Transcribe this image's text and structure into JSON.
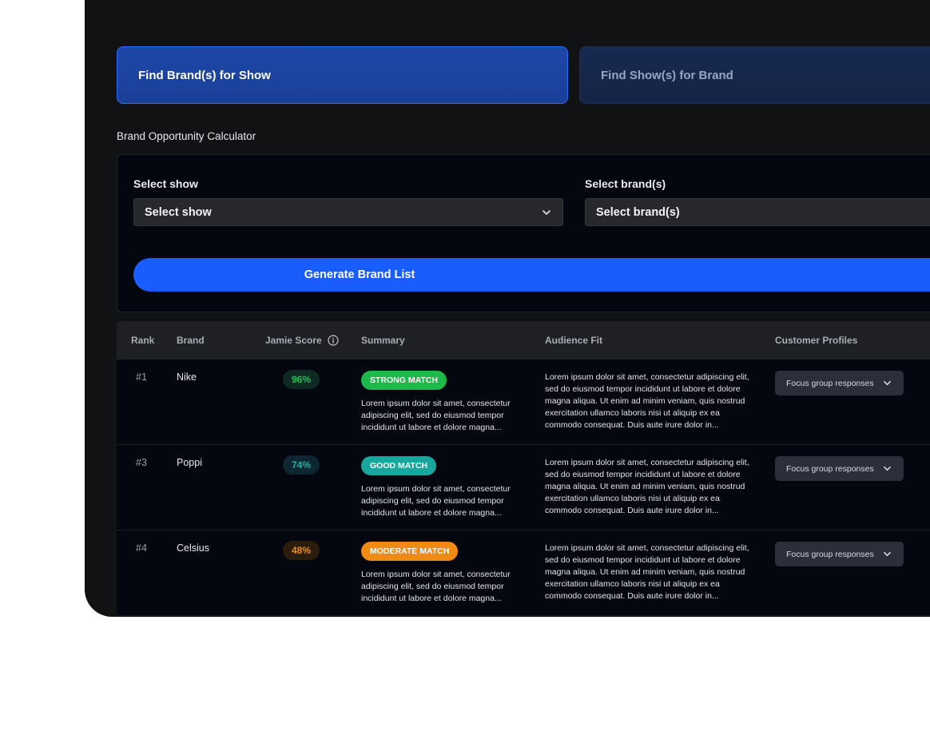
{
  "tabs": [
    {
      "label": "Find Brand(s) for Show",
      "active": true
    },
    {
      "label": "Find Show(s) for Brand",
      "active": false
    }
  ],
  "calculator": {
    "title": "Brand Opportunity Calculator",
    "show_label": "Select show",
    "show_value": "Select show",
    "brand_label": "Select brand(s)",
    "brand_value": "Select brand(s)",
    "generate_label": "Generate Brand List"
  },
  "table": {
    "headers": {
      "rank": "Rank",
      "brand": "Brand",
      "score": "Jamie Score",
      "summary": "Summary",
      "fit": "Audience Fit",
      "profiles": "Customer Profiles"
    },
    "rows": [
      {
        "rank": "#1",
        "brand": "Nike",
        "score": "96%",
        "match": "STRONG MATCH",
        "summary": "Lorem ipsum dolor sit amet, consectetur adipiscing elit, sed do eiusmod tempor incididunt ut labore et dolore magna...",
        "fit": "Lorem ipsum dolor sit amet, consectetur adipiscing elit, sed do eiusmod tempor incididunt ut labore et dolore magna aliqua. Ut enim ad minim veniam, quis nostrud exercitation ullamco laboris nisi ut aliquip ex ea commodo consequat. Duis aute irure dolor in...",
        "profiles": "Focus group responses"
      },
      {
        "rank": "#3",
        "brand": "Poppi",
        "score": "74%",
        "match": "GOOD MATCH",
        "summary": "Lorem ipsum dolor sit amet, consectetur adipiscing elit, sed do eiusmod tempor incididunt ut labore et dolore magna...",
        "fit": "Lorem ipsum dolor sit amet, consectetur adipiscing elit, sed do eiusmod tempor incididunt ut labore et dolore magna aliqua. Ut enim ad minim veniam, quis nostrud exercitation ullamco laboris nisi ut aliquip ex ea commodo consequat. Duis aute irure dolor in...",
        "profiles": "Focus group responses"
      },
      {
        "rank": "#4",
        "brand": "Celsius",
        "score": "48%",
        "match": "MODERATE MATCH",
        "summary": "Lorem ipsum dolor sit amet, consectetur adipiscing elit, sed do eiusmod tempor incididunt ut labore et dolore magna...",
        "fit": "Lorem ipsum dolor sit amet, consectetur adipiscing elit, sed do eiusmod tempor incididunt ut labore et dolore magna aliqua. Ut enim ad minim veniam, quis nostrud exercitation ullamco laboris nisi ut aliquip ex ea commodo consequat. Duis aute irure dolor in...",
        "profiles": "Focus group responses"
      }
    ]
  },
  "colors": {
    "accent": "#1a5dff",
    "strong": "#1db94a",
    "good": "#17a79c",
    "moderate": "#f08a12"
  },
  "icons": {
    "dropdown": "chevron-down-icon",
    "info": "info-icon"
  }
}
